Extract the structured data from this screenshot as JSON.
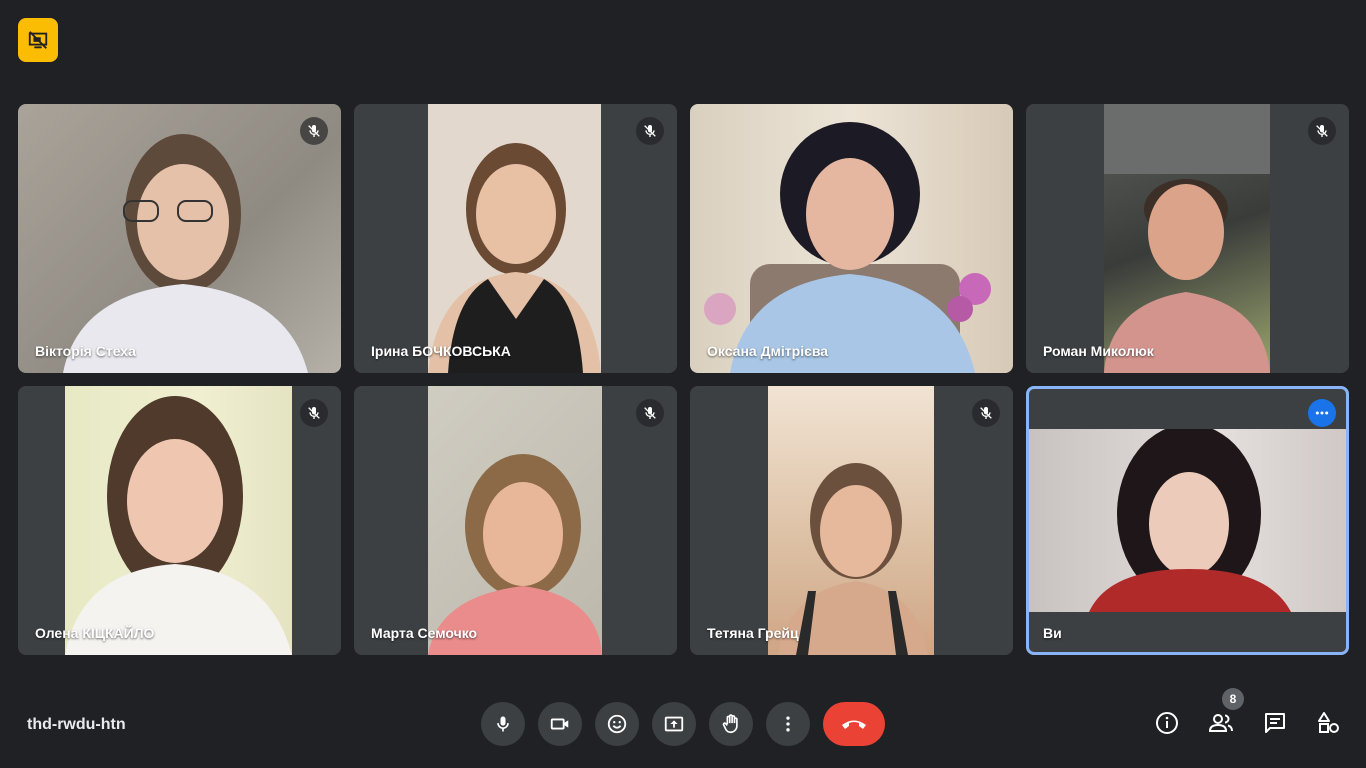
{
  "top_badge": {
    "icon": "no-present-icon",
    "color": "#fbbc04"
  },
  "participants": [
    {
      "name": "Вікторія Стеха",
      "muted": true
    },
    {
      "name": "Ірина БОЧКОВСЬКА",
      "muted": true
    },
    {
      "name": "Оксана Дмітрієва",
      "muted": false
    },
    {
      "name": "Роман Миколюк",
      "muted": true
    },
    {
      "name": "Олена КІЦКАЙЛО",
      "muted": true
    },
    {
      "name": "Марта Семочко",
      "muted": true
    },
    {
      "name": "Тетяна Грейц",
      "muted": true
    },
    {
      "name": "Ви",
      "muted": false,
      "self": true
    }
  ],
  "bottom_bar": {
    "meeting_code": "thd-rwdu-htn",
    "controls": [
      "microphone-icon",
      "camera-icon",
      "emoji-icon",
      "present-screen-icon",
      "raise-hand-icon",
      "more-options-icon",
      "hang-up-icon"
    ],
    "right_icons": [
      "info-icon",
      "people-icon",
      "chat-icon",
      "activities-icon"
    ],
    "participant_count": "8"
  },
  "colors": {
    "background": "#202124",
    "tile": "#3c4043",
    "hangup": "#ea4335",
    "self_border": "#8ab4f8",
    "accent": "#1a73e8"
  }
}
